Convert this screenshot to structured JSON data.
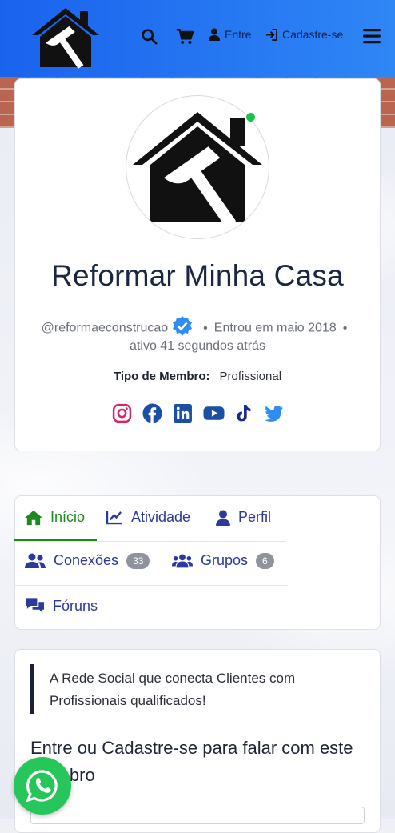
{
  "header": {
    "login_label": "Entre",
    "register_label": "Cadastre-se"
  },
  "profile": {
    "name": "Reformar Minha Casa",
    "handle": "@reformaeconstrucao",
    "joined": "Entrou em maio 2018",
    "active": "ativo 41 segundos atrás",
    "member_type_label": "Tipo de Membro:",
    "member_type_value": "Profissional",
    "online": true,
    "socials": [
      "instagram-icon",
      "facebook-icon",
      "linkedin-icon",
      "youtube-icon",
      "tiktok-icon",
      "twitter-icon"
    ]
  },
  "tabs": {
    "home": "Início",
    "activity": "Atividade",
    "profile": "Perfil",
    "connections": "Conexões",
    "connections_count": "33",
    "groups": "Grupos",
    "groups_count": "6",
    "forums": "Fóruns"
  },
  "info": {
    "quote": "A Rede Social que conecta Clientes com Profissionais qualificados!",
    "cta": "Entre ou Cadastre-se para falar com este Membro"
  },
  "colors": {
    "header": "#1a63ee",
    "active_tab": "#1c8a1c",
    "tab_link": "#2b3a9c",
    "whatsapp": "#27c65a",
    "verified": "#2f8cf0",
    "online": "#19c24a"
  }
}
